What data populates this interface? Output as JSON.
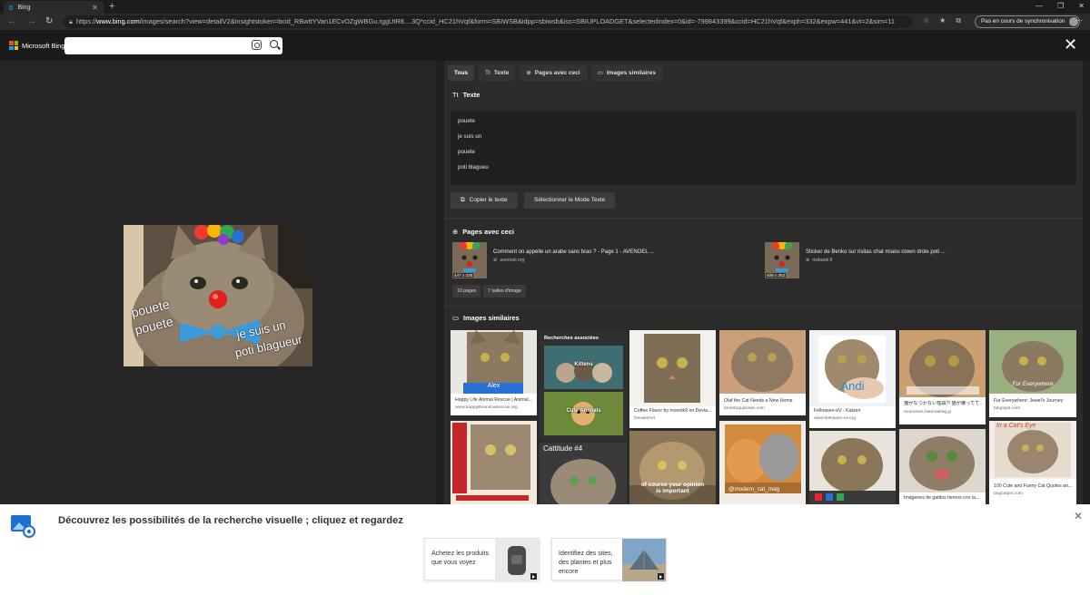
{
  "browser": {
    "tab_title": "Bing",
    "url_prefix": "https://",
    "url_host": "www.bing.com",
    "url_rest": "/images/search?view=detailV2&insightstoken=bcid_RBwttYVan1ECvOZgWBGu.rggUtR8....3Q*ccid_HC21hVqf&form=SBIWSB&idpp=sbiwsb&iss=SBIUPLOADGET&selectedindex=0&id=-799843399&ccid=HC21hVqf&exph=332&expw=441&vt=2&sim=11",
    "sync_label": "Pas en cours de synchronisation"
  },
  "header": {
    "logo_text": "Microsoft Bing",
    "search_value": ""
  },
  "main_image": {
    "overlay_texts": [
      "pouete",
      "pouete",
      "je suis un",
      "poti blagueur"
    ]
  },
  "panel": {
    "tabs": [
      {
        "label": "Tous",
        "icon": ""
      },
      {
        "label": "Texte",
        "icon": "Tt"
      },
      {
        "label": "Pages avec ceci",
        "icon": "⊕"
      },
      {
        "label": "Images similaires",
        "icon": "▭"
      }
    ],
    "text_section": {
      "title": "Texte",
      "lines": [
        "pouete",
        "je suis un",
        "pouete",
        "poti blagueu"
      ],
      "copy_button": "Copier le texte",
      "select_button": "Sélectionner le Mode Texte"
    },
    "pages_section": {
      "title": "Pages avec ceci",
      "results": [
        {
          "title": "Comment on appelle un arabe sans bras ? - Page 1 - AVENOEL ...",
          "source": "avenoel.org",
          "dims": "447 x 335"
        },
        {
          "title": "Sticker de Benko sur risitas chat miaou clown drole poti ...",
          "source": "risibank.fr",
          "dims": "408 x 352"
        }
      ],
      "chips": [
        "10 pages",
        "7 tailles d'image"
      ]
    },
    "similar_section": {
      "title": "Images similaires",
      "related_header": "Recherches associées",
      "related": [
        "Kittens",
        "Cute Animals"
      ],
      "cards": [
        {
          "caption": "Happy Life Animal Rescue | Animal...",
          "source": "www.happylifeanimalrescue.org",
          "overlay": "Alex"
        },
        {
          "caption": "Coffee Flavor by moonik9 on Devia...",
          "source": "DeviantArt",
          "overlay": ""
        },
        {
          "caption": "Olaf the Cat Needs a New Home",
          "source": "torontoguardian.com",
          "overlay": ""
        },
        {
          "caption": "Fellnasen-eV - Katzen",
          "source": "www.fellnasen-ev.org",
          "overlay": "Andi"
        },
        {
          "caption": "猫がなつかない理由?! 猫が嫌ってて...",
          "source": "momosan.hatenablog.jp",
          "overlay": ""
        },
        {
          "caption": "Fur Everywhere: Jewel's Journey",
          "source": "blogspot.com",
          "overlay": "Fur Everywhere"
        },
        {
          "caption": "",
          "source": "",
          "overlay": "Cattitude #4"
        },
        {
          "caption": "",
          "source": "",
          "overlay": "of course your opinion is important"
        },
        {
          "caption": "",
          "source": "",
          "overlay": "@modern_cat_mag"
        },
        {
          "caption": "Imágenes de gatitos tiernos con la...",
          "source": "",
          "overlay": ""
        },
        {
          "caption": "100 Cute and Funny Cat Quotes an...",
          "source": "dogcatpin.com",
          "overlay": "In a Cat's Eye"
        }
      ]
    }
  },
  "promo": {
    "title": "Découvrez les possibilités de la recherche visuelle ; cliquez et regardez",
    "cards": [
      {
        "text": "Achetez les produits que vous voyez"
      },
      {
        "text": "Identifiez des sites, des plantes et plus encore"
      }
    ]
  }
}
